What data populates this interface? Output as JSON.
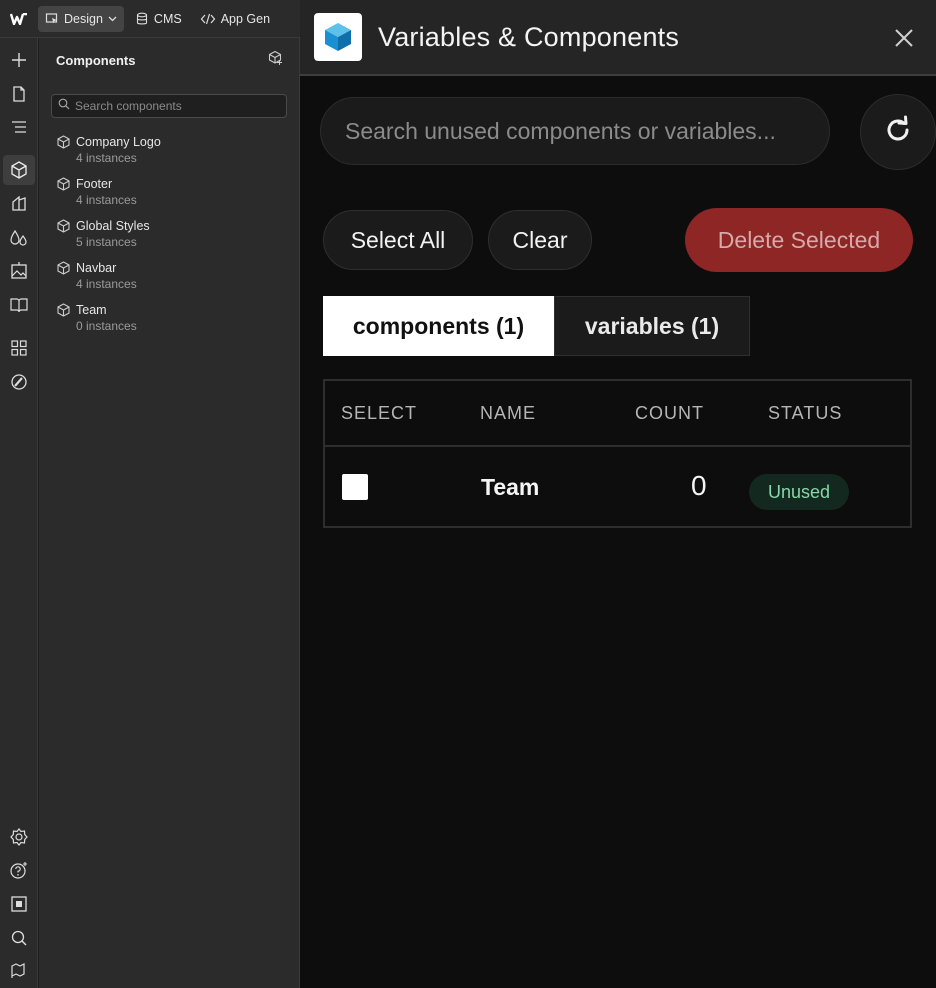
{
  "topbar": {
    "logo": "webflow-logo",
    "modes": [
      {
        "label": "Design",
        "icon": "cursor-icon",
        "active": true
      },
      {
        "label": "CMS",
        "icon": "database-icon",
        "active": false
      },
      {
        "label": "App Gen",
        "icon": "code-icon",
        "active": false
      }
    ]
  },
  "rail": {
    "top_icons": [
      "add-icon",
      "page-icon",
      "navigator-icon",
      "components-icon",
      "style-selectors-icon",
      "variables-icon",
      "assets-icon",
      "cms-book-icon",
      "apps-icon",
      "brush-icon"
    ],
    "bottom_icons": [
      "settings-icon",
      "help-icon",
      "stop-icon",
      "search-icon",
      "flag-icon"
    ],
    "active": "components-icon"
  },
  "components_panel": {
    "title": "Components",
    "search_placeholder": "Search components",
    "items": [
      {
        "name": "Company Logo",
        "count": "4 instances"
      },
      {
        "name": "Footer",
        "count": "4 instances"
      },
      {
        "name": "Global Styles",
        "count": "5 instances"
      },
      {
        "name": "Navbar",
        "count": "4 instances"
      },
      {
        "name": "Team",
        "count": "0 instances"
      }
    ]
  },
  "plugin": {
    "title": "Variables & Components",
    "search_placeholder": "Search unused components or variables...",
    "buttons": {
      "select_all": "Select All",
      "clear": "Clear",
      "delete_selected": "Delete Selected"
    },
    "tabs": [
      {
        "label": "components (1)",
        "active": true
      },
      {
        "label": "variables (1)",
        "active": false
      }
    ],
    "table": {
      "headers": [
        "SELECT",
        "NAME",
        "COUNT",
        "STATUS"
      ],
      "rows": [
        {
          "name": "Team",
          "count": "0",
          "status": "Unused"
        }
      ]
    },
    "colors": {
      "delete_bg": "#8e2626",
      "badge_bg": "#13291f",
      "badge_text": "#86d7ab"
    }
  }
}
